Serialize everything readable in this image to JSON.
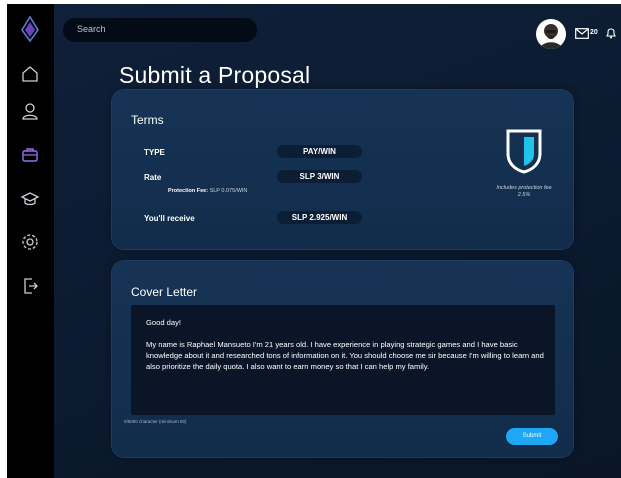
{
  "search": {
    "placeholder": "Search"
  },
  "header": {
    "mail_count": "20"
  },
  "page": {
    "title": "Submit a Proposal"
  },
  "terms": {
    "title": "Terms",
    "type_label": "TYPE",
    "type_value": "PAY/WIN",
    "rate_label": "Rate",
    "rate_currency": "SLP",
    "rate_value": "3/WIN",
    "protection_fee_label": "Protection Fee:",
    "protection_fee_value": "SLP  0.075/WIN",
    "receive_label": "You'll receive",
    "receive_currency": "SLP",
    "receive_value": "2.925/WIN",
    "protection_note_line1": "Includes protection fee",
    "protection_note_line2": "2.5%"
  },
  "cover_letter": {
    "title": "Cover Letter",
    "text": "Good day!\n\nMy name is Raphael Mansueto I'm 21 years old. I have experience in playing strategic games and I have basic knowledge about it and researched tons of information on it. You should choose me sir because I'm willing to learn and also prioritize the daily quota. I also want to earn money so that I can help my family.",
    "char_count": "0/5000 character (minimum 50)",
    "submit_label": "Submit"
  },
  "colors": {
    "accent": "#1ea7f4",
    "card": "#163355",
    "sidebar": "#000000",
    "shield": "#20c4e8"
  }
}
